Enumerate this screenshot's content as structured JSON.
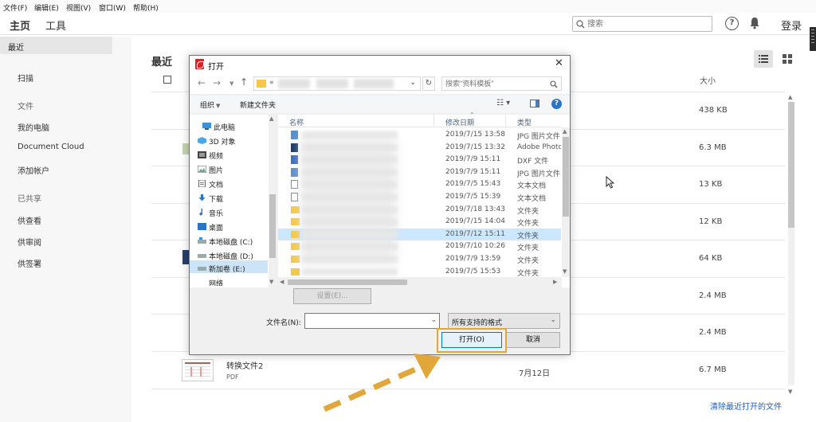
{
  "menubar": {
    "items": [
      "文件(F)",
      "编辑(E)",
      "视图(V)",
      "窗口(W)",
      "帮助(H)"
    ]
  },
  "toolbar": {
    "tabs": [
      "主页",
      "工具"
    ],
    "search_placeholder": "搜索",
    "help_label": "?",
    "login_label": "登录"
  },
  "sidebar": {
    "recent": "最近",
    "scan": "扫描",
    "files_header": "文件",
    "my_computer": "我的电脑",
    "document_cloud": "Document Cloud",
    "add_account": "添加帐户",
    "shared_header": "已共享",
    "for_review": "供查看",
    "for_approve": "供审阅",
    "for_sign": "供签署"
  },
  "main": {
    "title": "最近",
    "size_header": "大小",
    "sizes": [
      "438 KB",
      "6.3 MB",
      "13 KB",
      "12 KB",
      "64 KB",
      "2.4 MB",
      "2.4 MB",
      "6.7 MB"
    ],
    "last_file": {
      "name": "转换文件2",
      "type": "PDF",
      "date": "7月12日"
    },
    "clear_recent": "清除最近打开的文件"
  },
  "dialog": {
    "title": "打开",
    "close_label": "✕",
    "address_prefix": "«",
    "search_placeholder": "搜索\"资料模板\"",
    "organize": "组织",
    "new_folder": "新建文件夹",
    "nav_items": [
      {
        "label": "此电脑",
        "icon": "pc-icon"
      },
      {
        "label": "3D 对象",
        "icon": "cube-icon"
      },
      {
        "label": "视频",
        "icon": "video-icon"
      },
      {
        "label": "图片",
        "icon": "picture-icon"
      },
      {
        "label": "文档",
        "icon": "document-icon"
      },
      {
        "label": "下载",
        "icon": "download-icon"
      },
      {
        "label": "音乐",
        "icon": "music-icon"
      },
      {
        "label": "桌面",
        "icon": "desktop-icon"
      },
      {
        "label": "本地磁盘 (C:)",
        "icon": "drive-icon"
      },
      {
        "label": "本地磁盘 (D:)",
        "icon": "drive-icon"
      },
      {
        "label": "新加卷 (E:)",
        "icon": "drive-icon"
      },
      {
        "label": "网络",
        "icon": "network-icon"
      }
    ],
    "columns": {
      "name": "名称",
      "date": "修改日期",
      "type": "类型"
    },
    "files": [
      {
        "date": "2019/7/15 13:58",
        "type": "JPG 图片文件",
        "icon": "jpg-file-icon"
      },
      {
        "date": "2019/7/15 13:32",
        "type": "Adobe Photoshop",
        "icon": "psd-file-icon"
      },
      {
        "date": "2019/7/9 15:11",
        "type": "DXF 文件",
        "icon": "dxf-file-icon"
      },
      {
        "date": "2019/7/9 15:11",
        "type": "JPG 图片文件",
        "icon": "jpg-file-icon"
      },
      {
        "date": "2019/7/5 15:43",
        "type": "文本文档",
        "icon": "text-file-icon"
      },
      {
        "date": "2019/7/5 15:39",
        "type": "文本文档",
        "icon": "text-file-icon"
      },
      {
        "date": "2019/7/18 13:43",
        "type": "文件夹",
        "icon": "folder-icon"
      },
      {
        "date": "2019/7/15 14:04",
        "type": "文件夹",
        "icon": "folder-icon"
      },
      {
        "date": "2019/7/12 15:11",
        "type": "文件夹",
        "icon": "folder-icon",
        "selected": true
      },
      {
        "date": "2019/7/10 10:26",
        "type": "文件夹",
        "icon": "folder-icon"
      },
      {
        "date": "2019/7/9 13:59",
        "type": "文件夹",
        "icon": "folder-icon"
      },
      {
        "date": "2019/7/5 15:53",
        "type": "文件夹",
        "icon": "folder-icon"
      }
    ],
    "settings_label": "设置(E)...",
    "filename_label": "文件名(N):",
    "filename_value": "",
    "filter_value": "所有支持的格式",
    "open_label": "打开(O)",
    "cancel_label": "取消"
  },
  "colors": {
    "accent": "#0078d7",
    "highlight": "#e2a73a",
    "pdf_red": "#d0262a",
    "link": "#1f5fbf"
  }
}
